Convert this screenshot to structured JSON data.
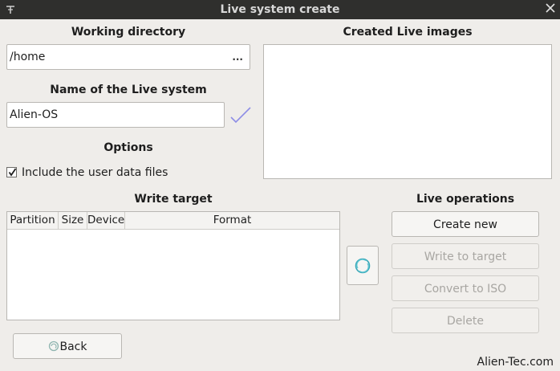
{
  "window": {
    "title": "Live system create"
  },
  "working_directory": {
    "label": "Working directory",
    "value": "/home",
    "browse_label": "..."
  },
  "live_name": {
    "label": "Name of the Live system",
    "value": "Alien-OS"
  },
  "options": {
    "label": "Options",
    "include_user_data": {
      "label": "Include the user data files",
      "checked": true
    }
  },
  "created_images": {
    "label": "Created Live images",
    "items": []
  },
  "write_target": {
    "label": "Write target",
    "columns": [
      "Partition",
      "Size",
      "Device",
      "Format"
    ],
    "rows": []
  },
  "live_operations": {
    "label": "Live operations",
    "create_new": "Create new",
    "write_to_target": "Write to target",
    "convert_to_iso": "Convert to ISO",
    "delete": "Delete"
  },
  "back_button": "Back",
  "brand": "Alien-Tec.com",
  "icons": {
    "window_menu": "pin-icon",
    "window_close": "close-icon",
    "confirm": "checkmark-icon",
    "refresh": "refresh-icon",
    "back": "back-icon"
  },
  "colors": {
    "titlebar": "#2f2f2d",
    "background": "#efedea",
    "disabled_text": "#a8a6a2",
    "check_accent": "#8e8ee6",
    "refresh_accent": "#3aa8b8"
  }
}
